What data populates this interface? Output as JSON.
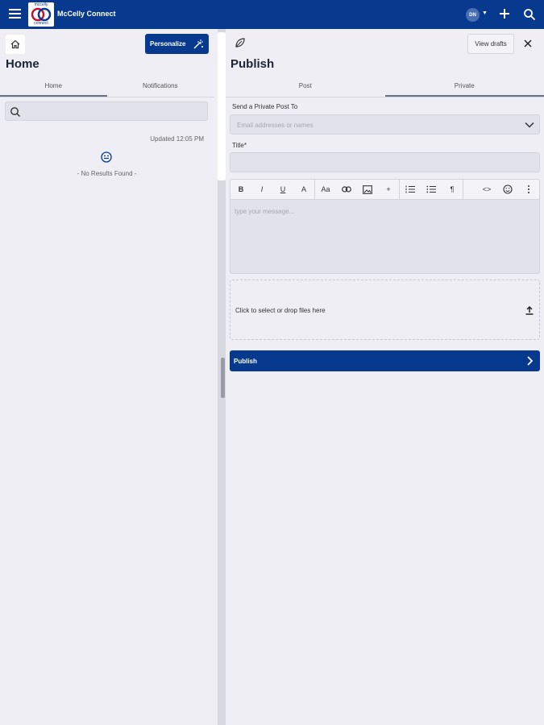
{
  "app": {
    "title": "McCelly Connect",
    "logo_top": "mccelly",
    "logo_bottom": "connect",
    "avatar_initials": "DN",
    "avatar_caret": "▼"
  },
  "left": {
    "title": "Home",
    "personalize_label": "Personalize",
    "tabs": [
      {
        "label": "Home",
        "active": true
      },
      {
        "label": "Notifications",
        "active": false
      }
    ],
    "updated": "Updated 12:05 PM",
    "no_results": "- No Results Found -"
  },
  "right": {
    "title": "Publish",
    "view_drafts_label": "View drafts",
    "tabs": [
      {
        "label": "Post",
        "active": false
      },
      {
        "label": "Private",
        "active": true
      }
    ],
    "send_label": "Send a Private Post To",
    "recipients_placeholder": "Email addresses or names",
    "title_label": "Title*",
    "title_value": "",
    "toolbar": [
      "B",
      "I",
      "U",
      "A",
      "Aa",
      "link",
      "image",
      "+",
      "ol",
      "ul",
      "¶",
      "<>",
      "emoji",
      "more"
    ],
    "editor_placeholder": "type your message...",
    "dropzone_label": "Click to select or drop files here",
    "publish_label": "Publish"
  },
  "colors": {
    "brand": "#073a8e",
    "background": "#eeeef4",
    "input_bg": "#e1e2ea"
  }
}
